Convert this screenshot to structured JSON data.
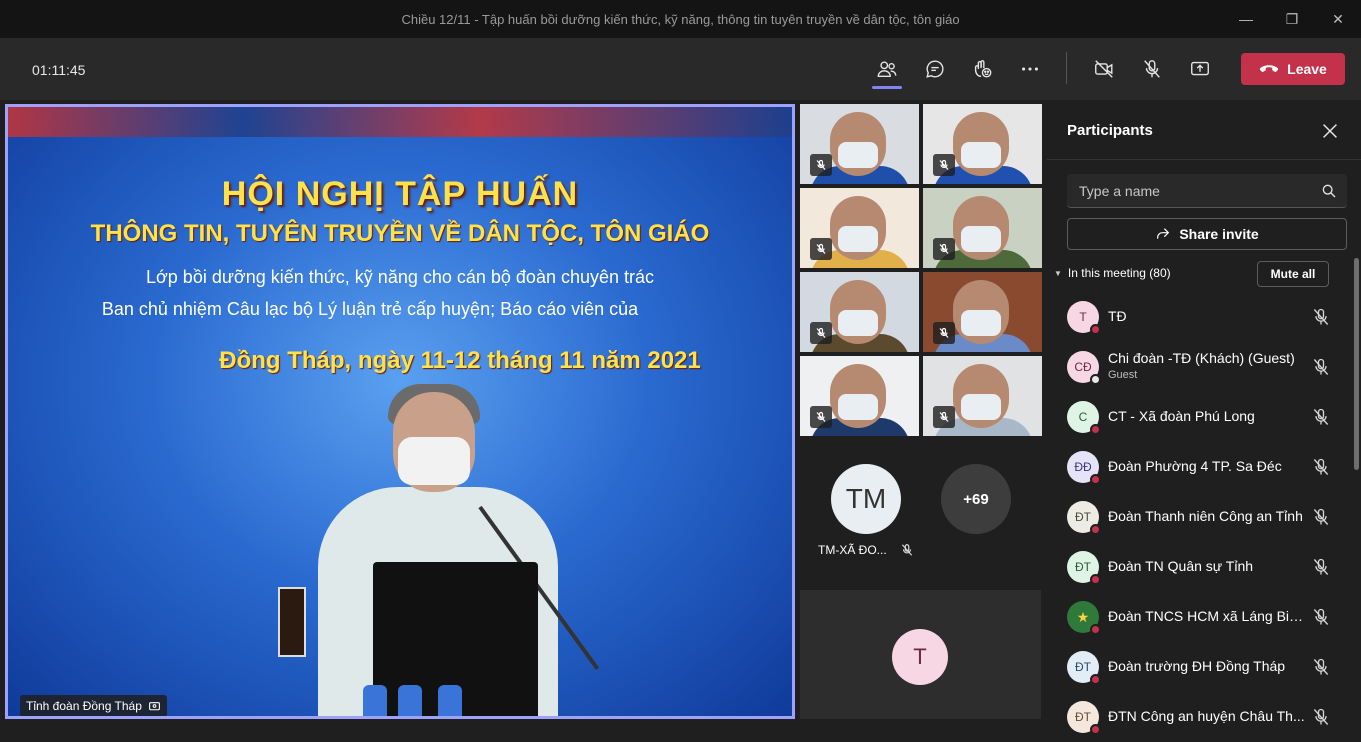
{
  "window": {
    "title": "Chiều 12/11 - Tập huấn bồi dưỡng kiến thức, kỹ năng, thông tin tuyên truyền về dân tộc, tôn giáo",
    "controls": [
      "minimize-icon",
      "restore-icon",
      "close-icon"
    ]
  },
  "toolbar": {
    "timer": "01:11:45",
    "buttons": [
      "people-icon",
      "chat-icon",
      "reactions-icon",
      "more-icon",
      "camera-off-icon",
      "mic-off-icon",
      "share-screen-icon"
    ],
    "leave_label": "Leave",
    "leave_color": "#c4314b"
  },
  "stage": {
    "slide": {
      "line1": "HỘI NGHỊ TẬP HUẤN",
      "line2": "THÔNG TIN, TUYÊN TRUYỀN VỀ DÂN TỘC, TÔN GIÁO",
      "line3": "Lớp bồi dưỡng kiến thức, kỹ năng cho cán bộ đoàn chuyên trác",
      "line4": "Ban chủ nhiệm Câu lạc bộ Lý luận trẻ cấp huyện; Báo cáo viên của",
      "line5": "Đồng Tháp, ngày 11-12 tháng 11 năm 2021"
    },
    "speaker_label": "Tỉnh đoàn Đồng Tháp",
    "border_color": "#9ea2ff"
  },
  "gallery": {
    "tiles": [
      {
        "bg": "#d9dde2",
        "shirt": "#1f4fa8"
      },
      {
        "bg": "#e6e6e6",
        "shirt": "#2051b0"
      },
      {
        "bg": "#f2e8dc",
        "shirt": "#e2b04a"
      },
      {
        "bg": "#c9d2c2",
        "shirt": "#4f6a3a"
      },
      {
        "bg": "#d2d9e0",
        "shirt": "#5b4a2e"
      },
      {
        "bg": "#8a4a30",
        "shirt": "#6a8ac8"
      },
      {
        "bg": "#eef0f2",
        "shirt": "#1e3a6a"
      },
      {
        "bg": "#e0e2e4",
        "shirt": "#a8b8c8"
      }
    ],
    "tm_initials": "TM",
    "tm_name": "TM-XÃ ĐO...",
    "overflow_count": "+69",
    "t_initial": "T"
  },
  "panel": {
    "title": "Participants",
    "search_placeholder": "Type a name",
    "share_invite_label": "Share invite",
    "in_meeting_label": "In this meeting (80)",
    "mute_all_label": "Mute all",
    "participants": [
      {
        "initials": "T",
        "name": "TĐ",
        "sub": "",
        "avatar_bg": "#f7d7e4",
        "avatar_fg": "#6b2b44",
        "status": "red"
      },
      {
        "initials": "CĐ",
        "name": "Chi đoàn -TĐ (Khách) (Guest)",
        "sub": "Guest",
        "avatar_bg": "#f7d7e4",
        "avatar_fg": "#6b2b44",
        "status": "guest"
      },
      {
        "initials": "C",
        "name": "CT - Xã đoàn Phú Long",
        "sub": "",
        "avatar_bg": "#dff4e4",
        "avatar_fg": "#2b5b38",
        "status": "red"
      },
      {
        "initials": "ĐĐ",
        "name": "Đoàn Phường 4 TP. Sa Đéc",
        "sub": "",
        "avatar_bg": "#e5e3f7",
        "avatar_fg": "#3b3686",
        "status": "red"
      },
      {
        "initials": "ĐT",
        "name": "Đoàn Thanh niên Công an Tỉnh",
        "sub": "",
        "avatar_bg": "#ecebe4",
        "avatar_fg": "#4a4a3a",
        "status": "red"
      },
      {
        "initials": "ĐT",
        "name": "Đoàn TN Quân sự Tỉnh",
        "sub": "",
        "avatar_bg": "#dff4e4",
        "avatar_fg": "#2b5b38",
        "status": "red"
      },
      {
        "initials": "",
        "name": "Đoàn TNCS HCM xã Láng Biể...",
        "sub": "",
        "avatar_bg": "#2f7a3a",
        "avatar_fg": "#ffffff",
        "status": "red"
      },
      {
        "initials": "ĐT",
        "name": "Đoàn trường ĐH Đồng Tháp",
        "sub": "",
        "avatar_bg": "#e3edf5",
        "avatar_fg": "#2b4a66",
        "status": "red"
      },
      {
        "initials": "ĐT",
        "name": "ĐTN Công an huyện Châu Th...",
        "sub": "",
        "avatar_bg": "#f4e8de",
        "avatar_fg": "#6a4a2a",
        "status": "red"
      }
    ]
  }
}
